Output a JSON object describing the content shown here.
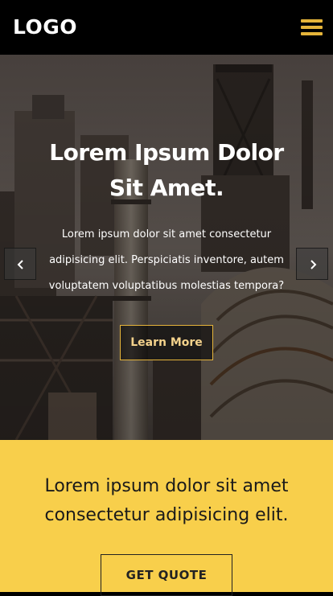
{
  "header": {
    "logo_text": "LOGO",
    "menu_icon": "hamburger-menu-icon",
    "accent_color": "#e5b43a"
  },
  "hero": {
    "title": "Lorem Ipsum Dolor Sit Amet.",
    "text": "Lorem ipsum dolor sit amet consectetur adipisicing elit. Perspiciatis inventore, autem voluptatem voluptatibus molestias tempora?",
    "button_label": "Learn More",
    "prev_icon": "chevron-left-icon",
    "next_icon": "chevron-right-icon",
    "background_image": "industrial plant photograph"
  },
  "cta": {
    "text": "Lorem ipsum dolor sit amet consectetur adipisicing elit.",
    "button_label": "GET QUOTE",
    "background_color": "#f8cf4b"
  }
}
